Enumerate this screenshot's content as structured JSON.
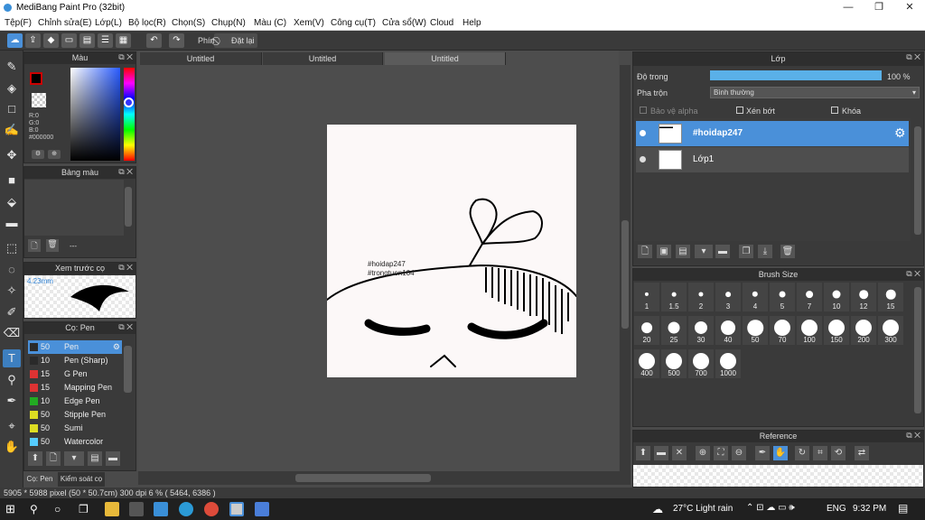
{
  "window": {
    "title": "MediBang Paint Pro (32bit)",
    "minimize": "—",
    "maximize": "❐",
    "close": "✕"
  },
  "menu": [
    "Tệp(F)",
    "Chỉnh sửa(E)",
    "Lớp(L)",
    "Bộ lọc(R)",
    "Chọn(S)",
    "Chụp(N)",
    "Màu (C)",
    "Xem(V)",
    "Công cụ(T)",
    "Cửa sổ(W)",
    "Cloud",
    "Help"
  ],
  "toolbar": {
    "phim_label": "Phím",
    "reset_label": "Đặt lại"
  },
  "tabs": [
    "Untitled",
    "Untitled",
    "Untitled"
  ],
  "color_panel": {
    "title": "Màu",
    "r": "R:0",
    "g": "G:0",
    "b": "B:0",
    "hex": "#000000"
  },
  "palette_panel": {
    "title": "Bảng màu",
    "dashes": "---"
  },
  "preview_panel": {
    "title": "Xem trước cọ",
    "size": "4.23mm"
  },
  "brush_panel": {
    "title": "Cọ: Pen",
    "items": [
      {
        "size": "50",
        "name": "Pen",
        "color": "#2a2a2a"
      },
      {
        "size": "10",
        "name": "Pen (Sharp)",
        "color": "#2a2a2a"
      },
      {
        "size": "15",
        "name": "G Pen",
        "color": "#d33"
      },
      {
        "size": "15",
        "name": "Mapping Pen",
        "color": "#d33"
      },
      {
        "size": "10",
        "name": "Edge Pen",
        "color": "#2a2"
      },
      {
        "size": "50",
        "name": "Stipple Pen",
        "color": "#dd2"
      },
      {
        "size": "50",
        "name": "Sumi",
        "color": "#dd2"
      },
      {
        "size": "50",
        "name": "Watercolor",
        "color": "#5cf"
      }
    ]
  },
  "bottom_tabs": {
    "brush": "Cọ: Pen",
    "inspect": "Kiểm soát cọ"
  },
  "layer_panel": {
    "title": "Lớp",
    "opacity_label": "Độ trong",
    "opacity_value": "100 %",
    "opacity_fraction": 1.0,
    "blend_label": "Pha trộn",
    "blend_value": "Bình thường",
    "protect_alpha": "Bảo vệ alpha",
    "clip": "Xén bớt",
    "lock": "Khóa",
    "layers": [
      {
        "name": "#hoidap247",
        "selected": true
      },
      {
        "name": "Lớp1",
        "selected": false
      }
    ]
  },
  "brush_size_panel": {
    "title": "Brush Size",
    "sizes": [
      "1",
      "1.5",
      "2",
      "3",
      "4",
      "5",
      "7",
      "10",
      "12",
      "15",
      "20",
      "25",
      "30",
      "40",
      "50",
      "70",
      "100",
      "150",
      "200",
      "300",
      "400",
      "500",
      "700",
      "1000"
    ]
  },
  "reference_panel": {
    "title": "Reference"
  },
  "canvas_text": {
    "line1": "#hoidap247",
    "line2": "#trongtuen104"
  },
  "status": {
    "text": "5905 * 5988 pixel  (50 * 50.7cm)  300 dpi  6 %  ( 5464, 6386 )"
  },
  "taskbar": {
    "weather": "27°C  Light rain",
    "lang": "ENG",
    "time": "9:32 PM"
  },
  "colors": {
    "accent": "#4a90d9",
    "panel": "#3a3a3a",
    "canvas_bg": "#4d4d4d",
    "selected_layer": "#4a90d9"
  }
}
